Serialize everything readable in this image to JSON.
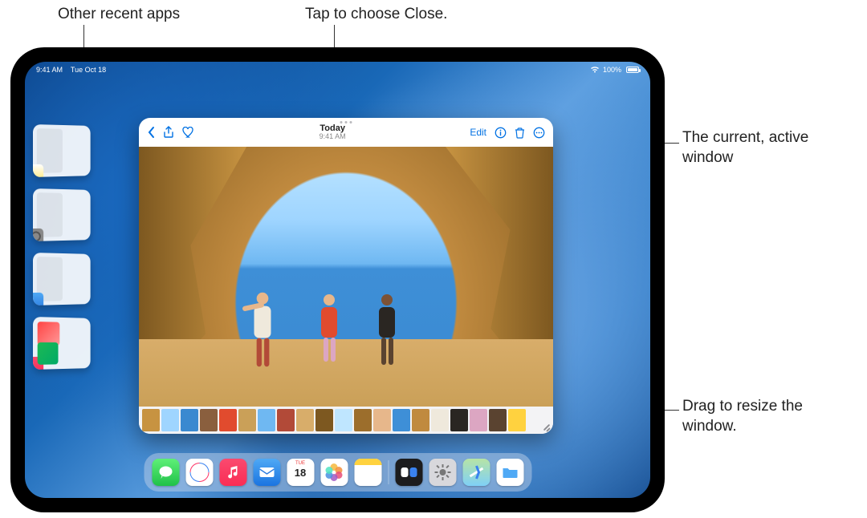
{
  "callouts": {
    "recent_apps": "Other recent apps",
    "close_hint": "Tap to choose Close.",
    "active_window": "The current, active window",
    "resize_hint": "Drag to resize the window."
  },
  "status_bar": {
    "time": "9:41 AM",
    "date": "Tue Oct 18",
    "wifi_icon": "wifi",
    "battery_percent": "100%"
  },
  "photos_window": {
    "title": "Today",
    "subtitle": "9:41 AM",
    "toolbar": {
      "back_icon": "chevron-left",
      "share_icon": "share",
      "favorite_icon": "heart",
      "edit_label": "Edit",
      "info_icon": "info",
      "trash_icon": "trash",
      "more_icon": "ellipsis-circle"
    },
    "thumbnail_strip_colors": [
      "#c79341",
      "#9fd5ff",
      "#3a89d0",
      "#8a5f3e",
      "#e14b2e",
      "#caa058",
      "#6fb8f2",
      "#b24a38",
      "#d8ad6a",
      "#7d5820",
      "#bfe6ff",
      "#9c6e2c",
      "#e7b78b",
      "#3e8fd7",
      "#c08a3f",
      "#efe9dc",
      "#2a2622",
      "#dca6c2",
      "#5a4330",
      "#ffd23f"
    ]
  },
  "recent_apps": [
    {
      "name": "Notes",
      "icon": "notes"
    },
    {
      "name": "Settings",
      "icon": "settings"
    },
    {
      "name": "Mail",
      "icon": "mail"
    },
    {
      "name": "Music",
      "icon": "music"
    }
  ],
  "dock": {
    "calendar_day_label": "TUE",
    "calendar_date": "18",
    "items_left": [
      {
        "name": "Messages",
        "class": "dk-messages"
      },
      {
        "name": "Safari",
        "class": "dk-safari"
      },
      {
        "name": "Music",
        "class": "dk-music"
      },
      {
        "name": "Mail",
        "class": "dk-mail"
      },
      {
        "name": "Calendar",
        "class": "dk-cal"
      },
      {
        "name": "Photos",
        "class": "dk-photos"
      },
      {
        "name": "Notes",
        "class": "dk-notes"
      }
    ],
    "items_right": [
      {
        "name": "Translate",
        "class": "dk-translate"
      },
      {
        "name": "Settings",
        "class": "dk-settings"
      },
      {
        "name": "Maps",
        "class": "dk-maps"
      },
      {
        "name": "Files",
        "class": "dk-files"
      }
    ]
  },
  "colors": {
    "accent": "#0071e3"
  }
}
